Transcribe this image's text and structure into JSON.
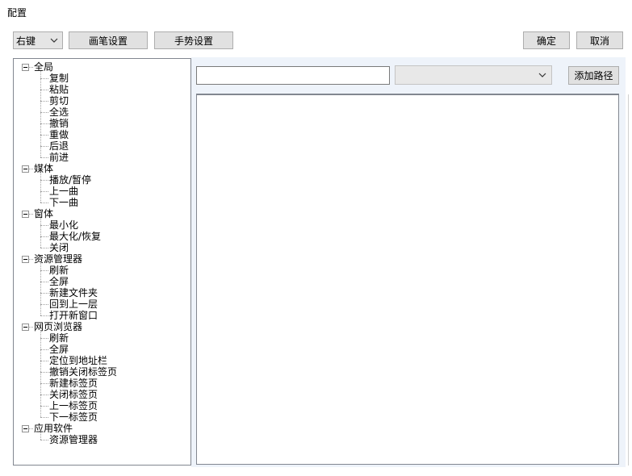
{
  "window": {
    "title": "配置"
  },
  "toolbar": {
    "trigger_select": {
      "value": "右键"
    },
    "pen_settings": "画笔设置",
    "gesture_settings": "手势设置",
    "ok": "确定",
    "cancel": "取消"
  },
  "detail": {
    "path_input": {
      "value": ""
    },
    "path_select": {
      "value": ""
    },
    "add_path": "添加路径"
  },
  "tree": [
    {
      "label": "全局",
      "children": [
        "复制",
        "粘贴",
        "剪切",
        "全选",
        "撤销",
        "重做",
        "后退",
        "前进"
      ]
    },
    {
      "label": "媒体",
      "children": [
        "播放/暂停",
        "上一曲",
        "下一曲"
      ]
    },
    {
      "label": "窗体",
      "children": [
        "最小化",
        "最大化/恢复",
        "关闭"
      ]
    },
    {
      "label": "资源管理器",
      "children": [
        "刷新",
        "全屏",
        "新建文件夹",
        "回到上一层",
        "打开新窗口"
      ]
    },
    {
      "label": "网页浏览器",
      "children": [
        "刷新",
        "全屏",
        "定位到地址栏",
        "撤销关闭标签页",
        "新建标签页",
        "关闭标签页",
        "上一标签页",
        "下一标签页"
      ]
    },
    {
      "label": "应用软件",
      "children": [
        "资源管理器"
      ]
    }
  ]
}
